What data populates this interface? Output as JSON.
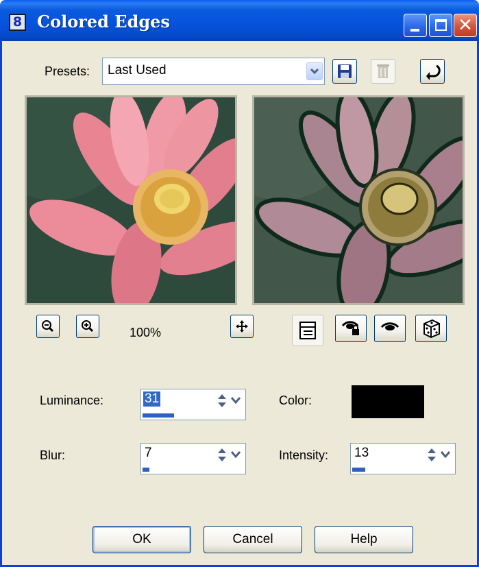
{
  "window": {
    "title": "Colored Edges",
    "app_icon_glyph": "8"
  },
  "titlebar_buttons": {
    "minimize_icon": "minimize-icon",
    "maximize_icon": "maximize-icon",
    "close_icon": "close-icon",
    "close_glyph": "✕"
  },
  "presets": {
    "label": "Presets:",
    "value": "Last Used"
  },
  "preview": {
    "zoom": "100%"
  },
  "params": {
    "luminance": {
      "label": "Luminance:",
      "value": "31",
      "level_fraction": 0.31
    },
    "blur": {
      "label": "Blur:",
      "value": "7",
      "level_fraction": 0.07
    },
    "color": {
      "label": "Color:",
      "value": "#000000"
    },
    "intensity": {
      "label": "Intensity:",
      "value": "13",
      "level_fraction": 0.13
    }
  },
  "buttons": {
    "ok": "OK",
    "cancel": "Cancel",
    "help": "Help"
  },
  "colors": {
    "title_bar": "#0553dc",
    "dialog_bg": "#ece9d8",
    "selection": "#316ac5",
    "spin_fill": "#2f5fbf"
  }
}
